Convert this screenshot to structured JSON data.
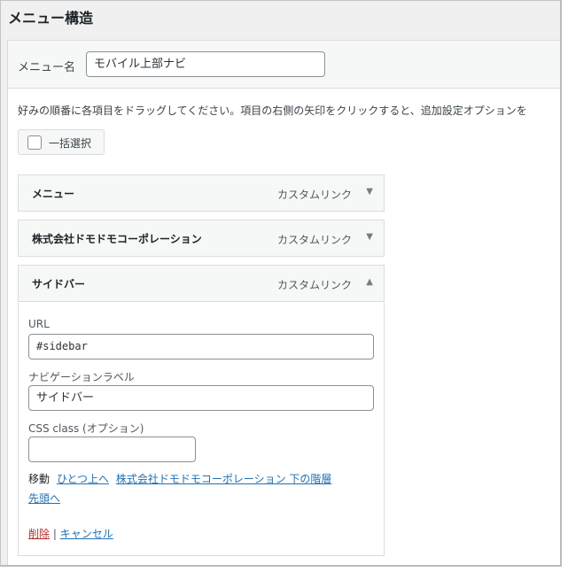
{
  "page": {
    "title": "メニュー構造"
  },
  "menu_name": {
    "label": "メニュー名",
    "value": "モバイル上部ナビ"
  },
  "instructions": "好みの順番に各項目をドラッグしてください。項目の右側の矢印をクリックすると、追加設定オプションを",
  "bulk_select": {
    "label": "一括選択",
    "checked": false
  },
  "items": [
    {
      "title": "メニュー",
      "type": "カスタムリンク",
      "toggle": "▼"
    },
    {
      "title": "株式会社ドモドモコーポレーション",
      "type": "カスタムリンク",
      "toggle": "▼"
    },
    {
      "title": "サイドバー",
      "type": "カスタムリンク",
      "toggle": "▲"
    }
  ],
  "settings": {
    "url_label": "URL",
    "url_value": "#sidebar",
    "nav_label": "ナビゲーションラベル",
    "nav_value": "サイドバー",
    "css_label": "CSS class (オプション)",
    "css_value": "",
    "move_label": "移動",
    "move_up": "ひとつ上へ",
    "move_under": "株式会社ドモドモコーポレーション 下の階層",
    "move_top": "先頭へ",
    "delete": "削除",
    "separator": "|",
    "cancel": "キャンセル"
  },
  "colors": {
    "link": "#2271b1",
    "delete": "#b32d2e",
    "header_bg": "#f6f7f7"
  }
}
